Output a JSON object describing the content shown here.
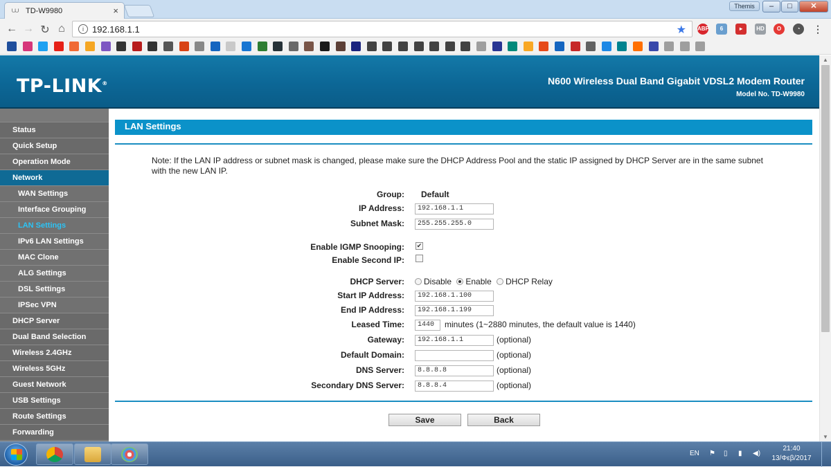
{
  "browser": {
    "tab_title": "TD-W9980",
    "tab_close": "×",
    "user_badge": "Themis",
    "url": "192.168.1.1",
    "win_min": "–",
    "win_max": "□",
    "win_close": "✕"
  },
  "header": {
    "brand": "TP-LINK",
    "brand_mark": "®",
    "product": "N600 Wireless Dual Band Gigabit VDSL2 Modem Router",
    "model": "Model No. TD-W9980"
  },
  "sidebar": {
    "items": [
      {
        "label": "Status"
      },
      {
        "label": "Quick Setup"
      },
      {
        "label": "Operation Mode"
      },
      {
        "label": "Network"
      },
      {
        "label": "WAN Settings"
      },
      {
        "label": "Interface Grouping"
      },
      {
        "label": "LAN Settings"
      },
      {
        "label": "IPv6 LAN Settings"
      },
      {
        "label": "MAC Clone"
      },
      {
        "label": "ALG Settings"
      },
      {
        "label": "DSL Settings"
      },
      {
        "label": "IPSec VPN"
      },
      {
        "label": "DHCP Server"
      },
      {
        "label": "Dual Band Selection"
      },
      {
        "label": "Wireless 2.4GHz"
      },
      {
        "label": "Wireless 5GHz"
      },
      {
        "label": "Guest Network"
      },
      {
        "label": "USB Settings"
      },
      {
        "label": "Route Settings"
      },
      {
        "label": "Forwarding"
      }
    ]
  },
  "page": {
    "title": "LAN Settings",
    "note": "Note: If the LAN IP address or subnet mask is changed, please make sure the DHCP Address Pool and the static IP assigned by DHCP Server are in the same subnet with the new LAN IP."
  },
  "form": {
    "group_label": "Group:",
    "group_value": "Default",
    "ip_label": "IP Address:",
    "ip_value": "192.168.1.1",
    "mask_label": "Subnet Mask:",
    "mask_value": "255.255.255.0",
    "igmp_label": "Enable IGMP Snooping:",
    "igmp_checked": true,
    "second_ip_label": "Enable Second IP:",
    "second_ip_checked": false,
    "dhcp_label": "DHCP Server:",
    "dhcp_options": [
      "Disable",
      "Enable",
      "DHCP Relay"
    ],
    "dhcp_selected": "Enable",
    "start_label": "Start IP Address:",
    "start_value": "192.168.1.100",
    "end_label": "End IP Address:",
    "end_value": "192.168.1.199",
    "lease_label": "Leased Time:",
    "lease_value": "1440",
    "lease_hint": "minutes (1~2880 minutes, the default value is 1440)",
    "gateway_label": "Gateway:",
    "gateway_value": "192.168.1.1",
    "domain_label": "Default Domain:",
    "domain_value": "",
    "dns_label": "DNS Server:",
    "dns_value": "8.8.8.8",
    "dns2_label": "Secondary DNS Server:",
    "dns2_value": "8.8.8.4",
    "optional": "(optional)"
  },
  "buttons": {
    "save": "Save",
    "back": "Back"
  },
  "taskbar": {
    "lang": "EN",
    "time": "21:40",
    "date": "13/Φεβ/2017"
  },
  "colors": {
    "header": "#0c6796",
    "title_bar": "#0b92c9",
    "sidebar": "#6d6d6d",
    "active_menu": "#0f6a95",
    "current_item": "#2cc4f6"
  }
}
